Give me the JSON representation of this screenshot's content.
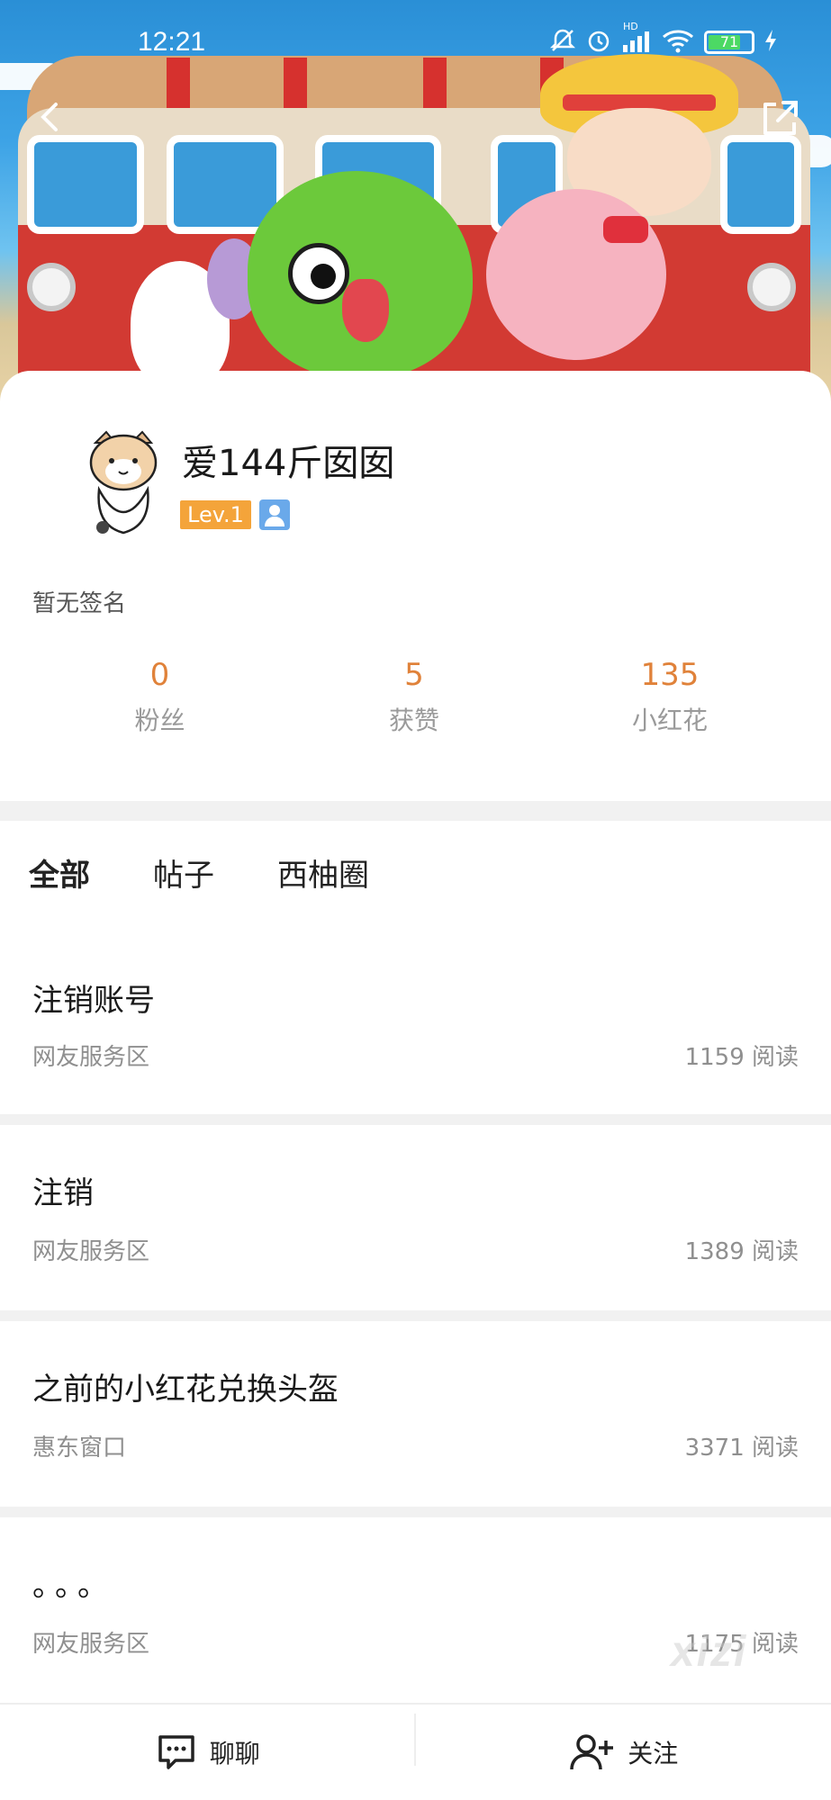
{
  "status_bar": {
    "time": "12:21",
    "battery": "71",
    "hd_label": "HD"
  },
  "nav": {
    "back_icon": "chevron-left-icon",
    "share_icon": "share-icon"
  },
  "profile": {
    "username": "爱144斤囡囡",
    "level": "Lev.1",
    "signature": "暂无签名",
    "stats": [
      {
        "value": "0",
        "label": "粉丝"
      },
      {
        "value": "5",
        "label": "获赞"
      },
      {
        "value": "135",
        "label": "小红花"
      }
    ]
  },
  "tabs": [
    {
      "label": "全部",
      "active": true
    },
    {
      "label": "帖子",
      "active": false
    },
    {
      "label": "西柚圈",
      "active": false
    }
  ],
  "posts": [
    {
      "title": "注销账号",
      "forum": "网友服务区",
      "reads": "1159 阅读"
    },
    {
      "title": "注销",
      "forum": "网友服务区",
      "reads": "1389 阅读"
    },
    {
      "title": "之前的小红花兑换头盔",
      "forum": "惠东窗口",
      "reads": "3371 阅读"
    },
    {
      "title": "。。。",
      "forum": "网友服务区",
      "reads": "1175 阅读"
    }
  ],
  "watermark": "xizi",
  "bottom_bar": {
    "chat_label": "聊聊",
    "follow_label": "关注"
  },
  "colors": {
    "accent_orange": "#e0823a",
    "level_badge": "#f4a43a",
    "tab_underline": "#7fc6f0"
  }
}
